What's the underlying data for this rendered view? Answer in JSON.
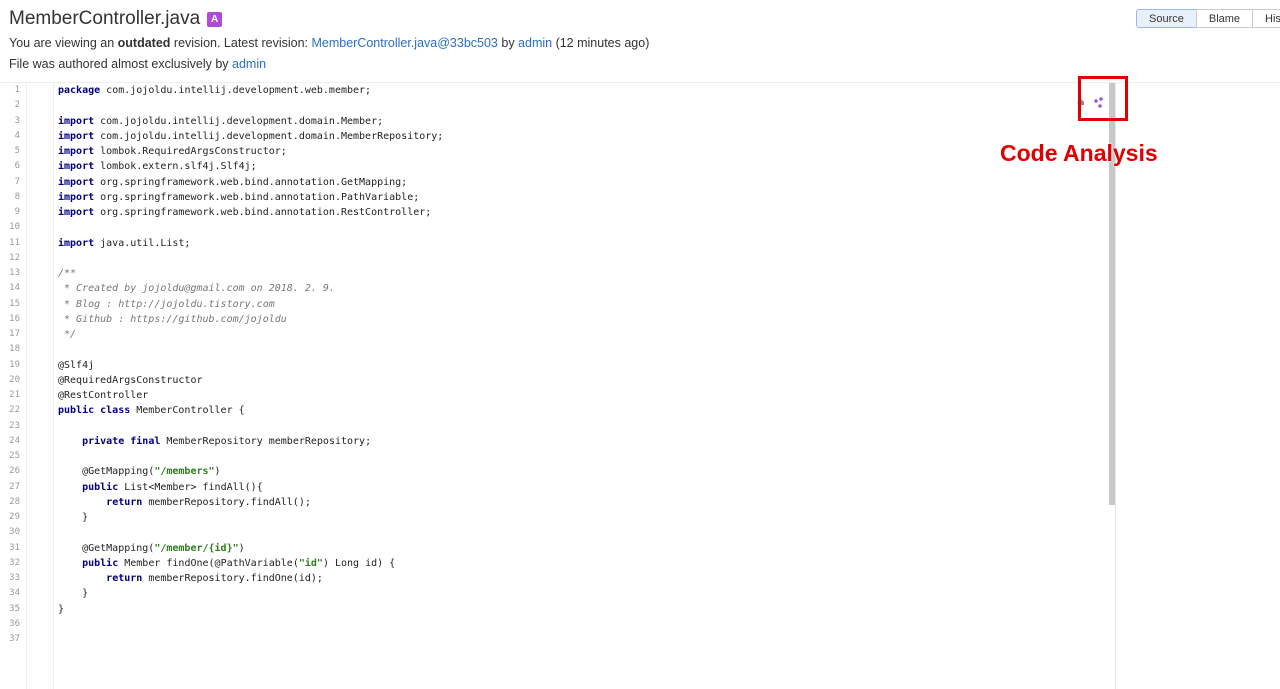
{
  "file": {
    "name": "MemberController.java",
    "badge": "A"
  },
  "revision_notice": {
    "prefix": "You are viewing an ",
    "status": "outdated",
    "middle": " revision. Latest revision: ",
    "latest_link": "MemberController.java@33bc503",
    "by": " by ",
    "author": "admin",
    "age": " (12 minutes ago)"
  },
  "authorship": {
    "text": "File was authored almost exclusively by ",
    "author": "admin"
  },
  "tabs": [
    {
      "label": "Source",
      "active": true
    },
    {
      "label": "Blame",
      "active": false
    },
    {
      "label": "His",
      "active": false
    }
  ],
  "code_lines": [
    [
      {
        "t": "package",
        "c": "kw"
      },
      {
        "t": " com.jojoldu.intellij.development.web.member;"
      }
    ],
    [],
    [
      {
        "t": "import",
        "c": "kw"
      },
      {
        "t": " com.jojoldu.intellij.development.domain.Member;"
      }
    ],
    [
      {
        "t": "import",
        "c": "kw"
      },
      {
        "t": " com.jojoldu.intellij.development.domain.MemberRepository;"
      }
    ],
    [
      {
        "t": "import",
        "c": "kw"
      },
      {
        "t": " lombok.RequiredArgsConstructor;"
      }
    ],
    [
      {
        "t": "import",
        "c": "kw"
      },
      {
        "t": " lombok.extern.slf4j.Slf4j;"
      }
    ],
    [
      {
        "t": "import",
        "c": "kw"
      },
      {
        "t": " org.springframework.web.bind.annotation.GetMapping;"
      }
    ],
    [
      {
        "t": "import",
        "c": "kw"
      },
      {
        "t": " org.springframework.web.bind.annotation.PathVariable;"
      }
    ],
    [
      {
        "t": "import",
        "c": "kw"
      },
      {
        "t": " org.springframework.web.bind.annotation.RestController;"
      }
    ],
    [],
    [
      {
        "t": "import",
        "c": "kw"
      },
      {
        "t": " java.util.List;"
      }
    ],
    [],
    [
      {
        "t": "/**",
        "c": "cm"
      }
    ],
    [
      {
        "t": " * Created by jojoldu@gmail.com on 2018. 2. 9.",
        "c": "cm"
      }
    ],
    [
      {
        "t": " * Blog : http://jojoldu.tistory.com",
        "c": "cm"
      }
    ],
    [
      {
        "t": " * Github : https://github.com/jojoldu",
        "c": "cm"
      }
    ],
    [
      {
        "t": " */",
        "c": "cm"
      }
    ],
    [],
    [
      {
        "t": "@Slf4j",
        "c": "an"
      }
    ],
    [
      {
        "t": "@RequiredArgsConstructor",
        "c": "an"
      }
    ],
    [
      {
        "t": "@RestController",
        "c": "an"
      }
    ],
    [
      {
        "t": "public class",
        "c": "kw"
      },
      {
        "t": " MemberController {"
      }
    ],
    [],
    [
      {
        "t": "    "
      },
      {
        "t": "private final",
        "c": "kw"
      },
      {
        "t": " MemberRepository memberRepository;"
      }
    ],
    [],
    [
      {
        "t": "    @GetMapping("
      },
      {
        "t": "\"/members\"",
        "c": "str"
      },
      {
        "t": ")"
      }
    ],
    [
      {
        "t": "    "
      },
      {
        "t": "public",
        "c": "kw"
      },
      {
        "t": " List<Member> findAll(){"
      }
    ],
    [
      {
        "t": "        "
      },
      {
        "t": "return",
        "c": "kw"
      },
      {
        "t": " memberRepository.findAll();"
      }
    ],
    [
      {
        "t": "    }"
      }
    ],
    [],
    [
      {
        "t": "    @GetMapping("
      },
      {
        "t": "\"/member/{id}\"",
        "c": "str"
      },
      {
        "t": ")"
      }
    ],
    [
      {
        "t": "    "
      },
      {
        "t": "public",
        "c": "kw"
      },
      {
        "t": " Member findOne(@PathVariable("
      },
      {
        "t": "\"id\"",
        "c": "str"
      },
      {
        "t": ") Long id) {"
      }
    ],
    [
      {
        "t": "        "
      },
      {
        "t": "return",
        "c": "kw"
      },
      {
        "t": " memberRepository.findOne(id);"
      }
    ],
    [
      {
        "t": "    }"
      }
    ],
    [
      {
        "t": "}"
      }
    ],
    [],
    []
  ],
  "annotation": {
    "label": "Code Analysis",
    "color": "#e00000"
  },
  "colors": {
    "link": "#2a6fc9",
    "keyword": "#000080",
    "string": "#2e7d1d",
    "comment": "#777777",
    "badge": "#b04ad8"
  }
}
